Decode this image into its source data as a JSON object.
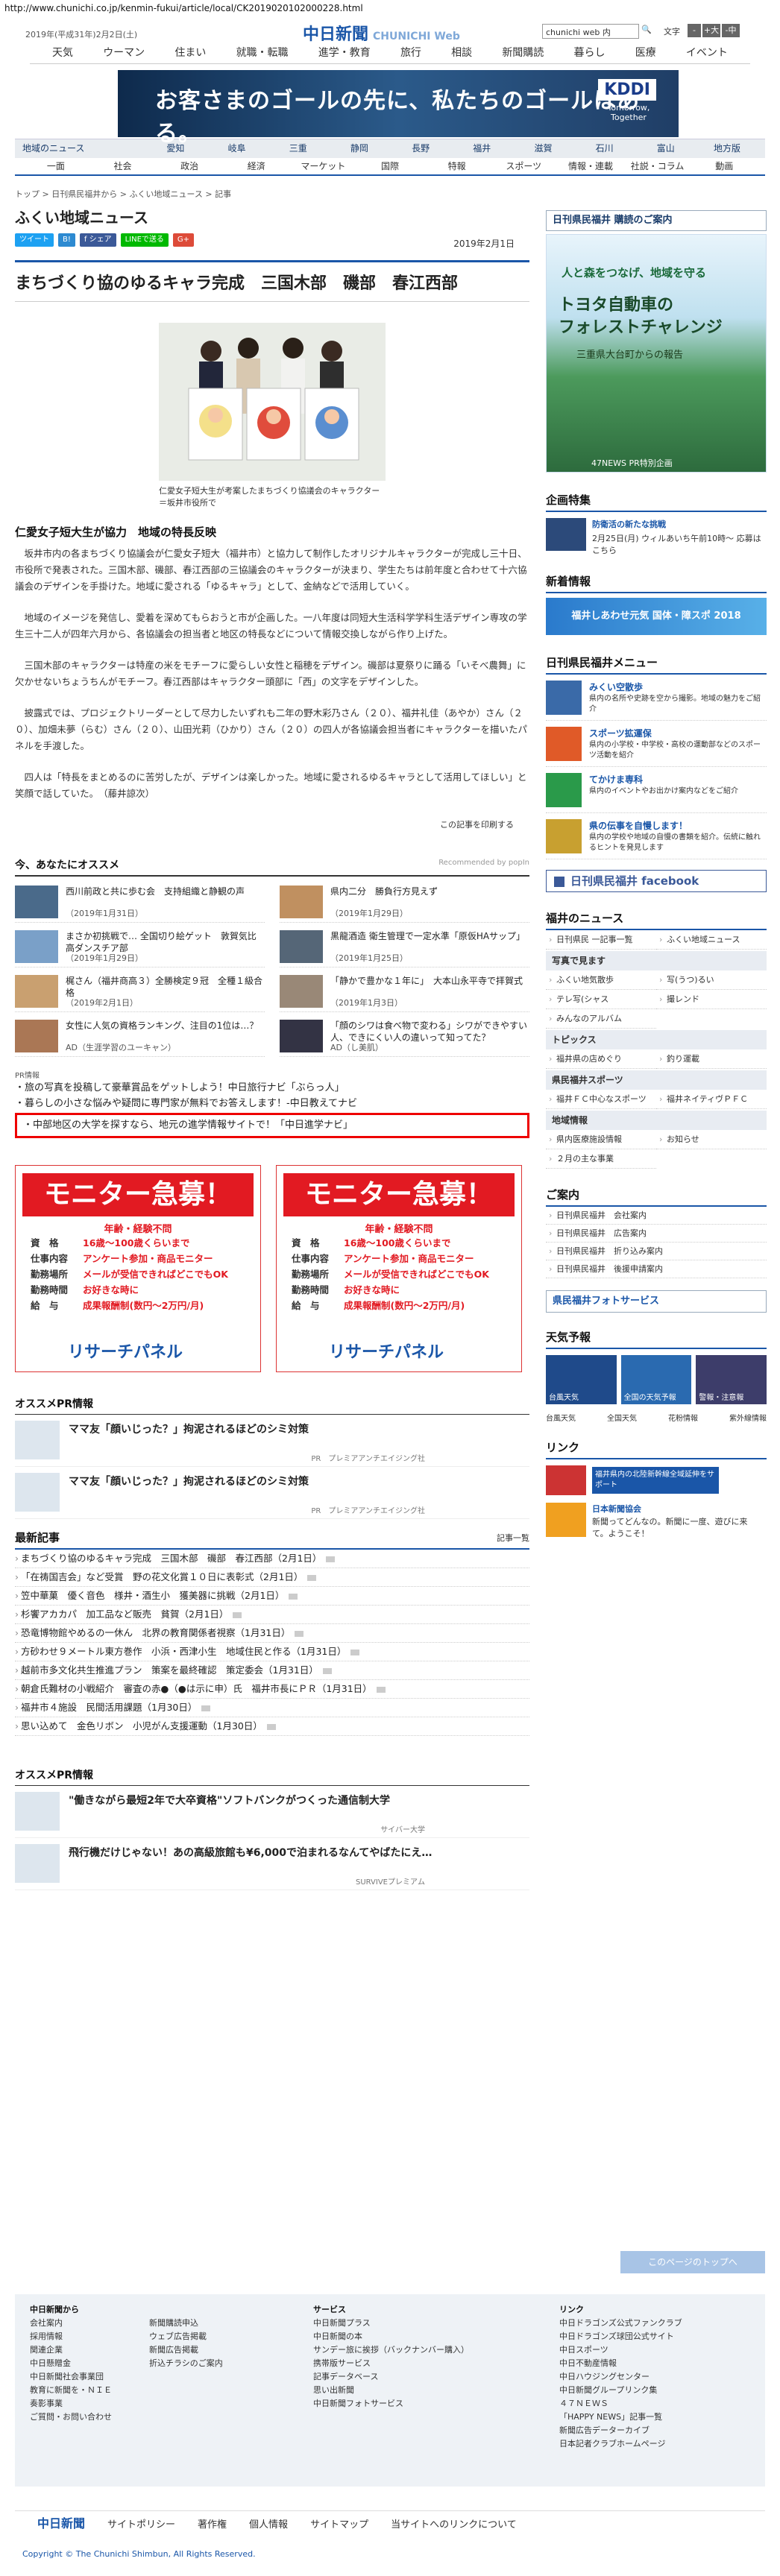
{
  "url": "http://www.chunichi.co.jp/kenmin-fukui/article/local/CK2019020102000228.html",
  "header": {
    "date": "2019年(平成31年)2月2日(土)",
    "logo_main": "中日新聞",
    "logo_sub": "CHUNICHI Web",
    "search_value": "chunichi web 内",
    "search_button": "🔍",
    "font_size_label": "文字",
    "font_small": "-",
    "font_large": "+大",
    "font_normal": "-中"
  },
  "global_nav": [
    "天気",
    "ウーマン",
    "住まい",
    "就職・転職",
    "進学・教育",
    "旅行",
    "相談",
    "新聞購読",
    "暮らし",
    "医療",
    "イベント"
  ],
  "ad": {
    "text": "お客さまのゴールの先に、私たちのゴールはある。",
    "brand": "KDDI",
    "sub": "Tomorrow, Together"
  },
  "region_nav": [
    "地域のニュース",
    "愛知",
    "岐阜",
    "三重",
    "静岡",
    "長野",
    "福井",
    "滋賀",
    "石川",
    "富山",
    "地方版"
  ],
  "category_nav": [
    "一面",
    "社会",
    "政治",
    "経済",
    "マーケット",
    "国際",
    "特報",
    "スポーツ",
    "情報・連載",
    "社説・コラム",
    "動画"
  ],
  "breadcrumb": "トップ > 日刊県民福井から > ふくい地域ニュース > 記事",
  "section_title": "ふくい地域ニュース",
  "sns": [
    "ツイート",
    "B!",
    "f シェア",
    "LINEで送る",
    "G+"
  ],
  "pubdate": "2019年2月1日",
  "article": {
    "headline": "まちづくり協のゆるキャラ完成　三国木部　磯部　春江西部",
    "caption": "仁愛女子短大生が考案したまちづくり協議会のキャラクター＝坂井市役所で",
    "subhead": "仁愛女子短大生が協力　地域の特長反映",
    "paragraphs": [
      "坂井市内の各まちづくり協議会が仁愛女子短大（福井市）と協力して制作したオリジナルキャラクターが完成し三十日、市役所で発表された。三国木部、磯部、春江西部の三協議会のキャラクターが決まり、学生たちは前年度と合わせて十六協議会のデザインを手掛けた。地域に愛される「ゆるキャラ」として、金納などで活用していく。",
      "地域のイメージを発信し、愛着を深めてもらおうと市が企画した。一八年度は同短大生活科学学科生活デザイン専攻の学生三十二人が四年六月から、各協議会の担当者と地区の特長などについて情報交換しながら作り上げた。",
      "三国木部のキャラクターは特産の米をモチーフに愛らしい女性と稲穂をデザイン。磯部は夏祭りに踊る「いそべ農舞」に欠かせないちょうちんがモチーフ。春江西部はキャラクター頭部に「西」の文字をデザインした。",
      "披露式では、プロジェクトリーダーとして尽力したいずれも二年の野木彩乃さん（２０）、福井礼佳（あやか）さん（２０）、加畑未夢（らむ）さん（２０）、山田光莉（ひかり）さん（２０）の四人が各協議会担当者にキャラクターを描いたパネルを手渡した。",
      "四人は「特長をまとめるのに苦労したが、デザインは楽しかった。地域に愛されるゆるキャラとして活用してほしい」と笑顔で話していた。　（藤井諒次）"
    ],
    "print_label": "この記事を印刷する"
  },
  "recommend": {
    "title": "今、あなたにオススメ",
    "powered": "Recommended by popIn",
    "items": [
      {
        "text": "西川前政と共に歩む会　支持組織と静観の声",
        "date": "（2019年1月31日）"
      },
      {
        "text": "県内二分　勝負行方見えず",
        "date": "（2019年1月29日）"
      },
      {
        "text": "まさか初挑戦で… 全国切り絵ゲット　敦賀気比高ダンスチア部",
        "date": "（2019年1月29日）"
      },
      {
        "text": "黒龍酒造 衛生管理で一定水準「原仮HAサップ」",
        "date": "（2019年1月25日）"
      },
      {
        "text": "梶さん（福井商高３）全勝検定９冠　全種１級合格",
        "date": "（2019年2月1日）"
      },
      {
        "text": "「静かで豊かな１年に」　大本山永平寺で拝賀式",
        "date": "（2019年1月3日）"
      },
      {
        "text": "女性に人気の資格ランキング、注目の1位は…？",
        "date": "AD（生涯学習のユーキャン）"
      },
      {
        "text": "「顔のシワは食べ物で変わる」シワができやすい人、できにくい人の違いって知ってた？",
        "date": "AD（し美肌）"
      }
    ]
  },
  "pr": {
    "label": "PR情報",
    "lines": [
      "・旅の写真を投稿して豪華賞品をゲットしよう！中日旅行ナビ「ぶらっ人」",
      "・暮らしの小さな悩みや疑問に専門家が無料でお答えします！-中日教えてナビ"
    ],
    "highlight": "・中部地区の大学を探すなら、地元の進学情報サイトで！「中日進学ナビ」"
  },
  "monitor": {
    "title": "モニター急募！",
    "sub": "年齢・経験不問",
    "rows": [
      {
        "k": "資　格",
        "v": "16歳～100歳くらいまで"
      },
      {
        "k": "仕事内容",
        "v": "アンケート参加・商品モニター"
      },
      {
        "k": "勤務場所",
        "v": "メールが受信できればどこでもOK"
      },
      {
        "k": "勤務時間",
        "v": "お好きな時に"
      },
      {
        "k": "給　与",
        "v": "成果報酬制(数円～2万円/月)"
      }
    ],
    "brand": "リサーチパネル"
  },
  "ospr1": {
    "title": "オススメPR情報",
    "items": [
      {
        "t": "ママ友「顔いじった？」拘泥されるほどのシミ対策",
        "pr": "PR　プレミアアンチエイジング社"
      },
      {
        "t": "ママ友「顔いじった？」拘泥されるほどのシミ対策",
        "pr": "PR　プレミアアンチエイジング社"
      }
    ]
  },
  "latest": {
    "title": "最新記事",
    "more": "記事一覧",
    "items": [
      "まちづくり協のゆるキャラ完成　三国木部　磯部　春江西部（2月1日）",
      "「在祷国吉会」など受賞　野の花文化賞１０日に表彰式（2月1日）",
      "笠中華菓　優く音色　様井・酒生小　獲美器に挑戦（2月1日）",
      "杉饗アカカパ　加工品など販売　貧賀（2月1日）",
      "恐竜博物館やめるの一休ん　北界の教育関係者視察（1月31日）",
      "方砂わせ９メートル東方巻作　小浜・西津小生　地域住民と作る（1月31日）",
      "越前市多文化共生推進プラン　策案を最終確認　策定委会（1月31日）",
      "朝倉氏難材の小戦紹介　審査の赤●（●は示に申）氏　福井市長にＰＲ（1月31日）",
      "福井市４施設　民間活用課題（1月30日）",
      "思い込めて　金色リボン　小児がん支援運動（1月30日）"
    ]
  },
  "ospr2": {
    "title": "オススメPR情報",
    "items": [
      {
        "t": "\"働きながら最短2年で大卒資格\"ソフトバンクがつくった通信制大学",
        "pr": "サイバー大学"
      },
      {
        "t": "飛行機だけじゃない！あの高級旅館も¥6,000で泊まれるなんてやばたにえ…",
        "pr": "SURVIVEプレミアム"
      }
    ]
  },
  "right": {
    "banner1_title": "日刊県民福井 購読のご案内",
    "toyota_title": "人と森をつなげ、地域を守る",
    "toyota_big": "トヨタ自動車の\nフォレストチャレンジ",
    "toyota_sub": "三重県大台町からの報告",
    "toyota_pr": "47NEWS PR特別企画",
    "kikaku_title": "企画特集",
    "kikaku_text1": "防衛活の新たな挑戦",
    "kikaku_text2": "2月25日(月) ウィルあいち午前10時～ 応募はこちら",
    "shinsei_title": "新着情報",
    "fukui_banner": "福井しあわせ元気 国体・障スポ 2018",
    "menu_title": "日刊県民福井メニュー",
    "menu_items": [
      {
        "h": "みくい空散歩",
        "t": "県内の名所や史跡を空から撮影。地域の魅力をご紹介"
      },
      {
        "h": "スポーツ拡運保",
        "t": "県内の小学校・中学校・高校の運動部などのスポーツ活動を紹介"
      },
      {
        "h": "てかけま専科",
        "t": "県内のイベントやお出かけ案内などをご紹介"
      },
      {
        "h": "県の伝事を自慢します！",
        "t": "県内の学校や地域の自慢の書類を紹介。伝統に触れるヒントを発見します"
      }
    ],
    "fb_label": "日刊県民福井 facebook",
    "fukui_news_title": "福井のニュース",
    "fukui_news": [
      "日刊県民 一記事一覧",
      "ふくい地域ニュース"
    ],
    "photo_title": "写真で見ます",
    "photo_items": [
      "ふくい地気散歩",
      "写(うつ)るい",
      "テレ写(シャス",
      "撮レンド",
      "みんなのアルバム"
    ],
    "topics_title": "トピックス",
    "topics_items": [
      "福井県の店めぐり",
      "釣り運載"
    ],
    "sports_title": "県民福井スポーツ",
    "sports_items": [
      "福井ＦＣ中心なスポーツ",
      "福井ネイティヴＰＦＣ"
    ],
    "region_title": "地域情報",
    "region_items": [
      "県内医療施設情報",
      "お知らせ",
      "２月の主な事業"
    ],
    "annai_title": "ご案内",
    "annai_items": [
      "日刊県民福井　会社案内",
      "日刊県民福井　広告案内",
      "日刊県民福井　折り込み案内",
      "日刊県民福井　後援申請案内"
    ],
    "kenmin_fhs": "県民福井フォトサービス",
    "tenki_title": "天気予報",
    "tenki_labels": [
      "台風天気",
      "全国天気",
      "全国の天気予報",
      "警報・注意報",
      "花粉情報",
      "紫外線情報"
    ],
    "link_title": "リンク",
    "link_text1": "福井県内の北陸新幹線全域延伸をサポート",
    "link_text2": "日本新聞協会",
    "link_text3": "新聞ってどんなの。新聞に一度、遊びに来て。ようこそ！"
  },
  "footer": {
    "col1_title": "中日新聞から",
    "col1": [
      "会社案内",
      "採用情報",
      "関連企業",
      "中日懸贈金",
      "中日新聞社会事業団",
      "教育に新聞を・ＮＩＥ",
      "奏影事業",
      "ご質問・お問い合わせ"
    ],
    "col2_title": "",
    "col2": [
      "新聞購読申込",
      "ウェブ広告掲載",
      "新聞広告掲載",
      "折込チラシのご案内"
    ],
    "col3_title": "サービス",
    "col3": [
      "中日新聞プラス",
      "中日新聞の本",
      "サンデー旅に挨拶（バックナンバー購入）",
      "携帯版サービス",
      "記事データベース",
      "思い出新聞",
      "中日新聞フォトサービス"
    ],
    "col4_title": "リンク",
    "col4": [
      "中日ドラゴンズ公式ファンクラブ",
      "中日ドラゴンズ球団公式サイト",
      "中日スポーツ",
      "中日不動産情報",
      "中日ハウジングセンター",
      "中日新聞グループリンク集",
      "４７ＮＥＷＳ",
      "「HAPPY NEWS」記事一覧",
      "新聞広告データーカイブ",
      "日本記者クラブホームページ"
    ],
    "totop": "このページのトップへ",
    "bar": [
      "中日新聞",
      "サイトポリシー",
      "著作権",
      "個人情報",
      "サイトマップ",
      "当サイトへのリンクについて"
    ],
    "copyright": "Copyright © The Chunichi Shimbun, All Rights Reserved."
  }
}
